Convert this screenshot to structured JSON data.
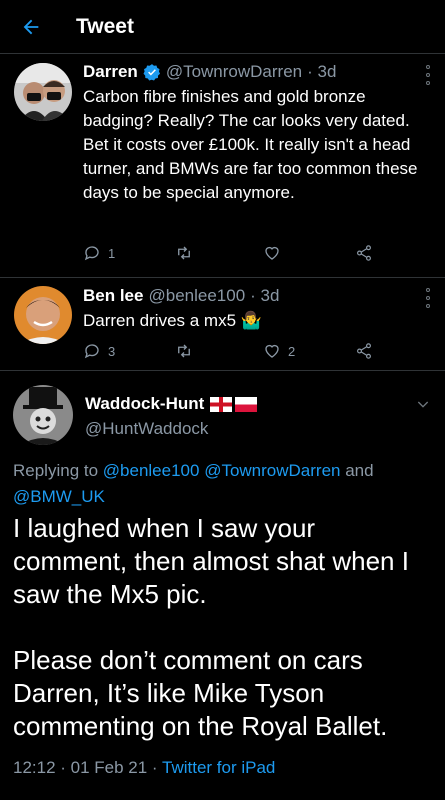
{
  "header": {
    "title": "Tweet",
    "back_icon": "arrow-left-icon"
  },
  "colors": {
    "accent": "#1d9bf0",
    "muted": "#8b98a5",
    "background": "#000000",
    "divider": "#2f3336",
    "verified": "#1d9bf0"
  },
  "replies": [
    {
      "name": "Darren",
      "handle": "@TownrowDarren",
      "time": "· 3d",
      "verified": true,
      "text": "Carbon fibre finishes and gold bronze badging? Really? The car looks very dated. Bet it costs over £100k. It really isn't a head turner, and BMWs are far too common these days to be special anymore.",
      "counts": {
        "reply": "1",
        "retweet": "",
        "like": ""
      }
    },
    {
      "name": "Ben lee",
      "handle": "@benlee100",
      "time": "· 3d",
      "verified": false,
      "text": "Darren drives a mx5 🤷‍♂️",
      "counts": {
        "reply": "3",
        "retweet": "",
        "like": "2"
      }
    }
  ],
  "main": {
    "name": "Waddock-Hunt",
    "flags": [
      "england-flag",
      "poland-flag"
    ],
    "handle": "@HuntWaddock",
    "replying_prefix": "Replying to ",
    "replying_to": [
      "@benlee100",
      "@TownrowDarren"
    ],
    "replying_and": " and ",
    "replying_last": "@BMW_UK",
    "text": "I laughed when I saw your comment, then almost shat when I saw the Mx5 pic.\n\nPlease don’t comment on cars Darren, It’s like Mike Tyson commenting on the Royal Ballet.",
    "timestamp": "12:12 · 01 Feb 21 · ",
    "source": "Twitter for iPad"
  }
}
